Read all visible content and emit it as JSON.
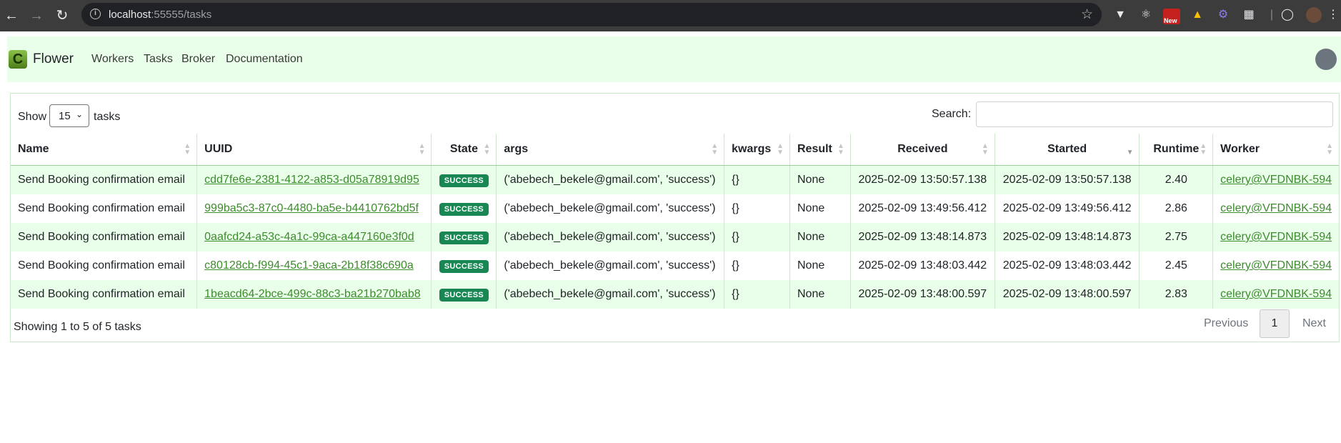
{
  "browser": {
    "url_host": "localhost",
    "url_rest": ":55555/tasks",
    "new_badge": "New"
  },
  "nav": {
    "brand": "Flower",
    "links": [
      "Workers",
      "Tasks",
      "Broker",
      "Documentation"
    ]
  },
  "table_controls": {
    "show_label": "Show",
    "page_size": "15",
    "tasks_label": "tasks",
    "search_label": "Search:"
  },
  "columns": [
    "Name",
    "UUID",
    "State",
    "args",
    "kwargs",
    "Result",
    "Received",
    "Started",
    "Runtime",
    "Worker"
  ],
  "rows": [
    {
      "name": "Send Booking confirmation email",
      "uuid": "cdd7fe6e-2381-4122-a853-d05a78919d95",
      "state": "SUCCESS",
      "args": "('abebech_bekele@gmail.com', 'success')",
      "kwargs": "{}",
      "result": "None",
      "received": "2025-02-09 13:50:57.138",
      "started": "2025-02-09 13:50:57.138",
      "runtime": "2.40",
      "worker": "celery@VFDNBK-594"
    },
    {
      "name": "Send Booking confirmation email",
      "uuid": "999ba5c3-87c0-4480-ba5e-b4410762bd5f",
      "state": "SUCCESS",
      "args": "('abebech_bekele@gmail.com', 'success')",
      "kwargs": "{}",
      "result": "None",
      "received": "2025-02-09 13:49:56.412",
      "started": "2025-02-09 13:49:56.412",
      "runtime": "2.86",
      "worker": "celery@VFDNBK-594"
    },
    {
      "name": "Send Booking confirmation email",
      "uuid": "0aafcd24-a53c-4a1c-99ca-a447160e3f0d",
      "state": "SUCCESS",
      "args": "('abebech_bekele@gmail.com', 'success')",
      "kwargs": "{}",
      "result": "None",
      "received": "2025-02-09 13:48:14.873",
      "started": "2025-02-09 13:48:14.873",
      "runtime": "2.75",
      "worker": "celery@VFDNBK-594"
    },
    {
      "name": "Send Booking confirmation email",
      "uuid": "c80128cb-f994-45c1-9aca-2b18f38c690a",
      "state": "SUCCESS",
      "args": "('abebech_bekele@gmail.com', 'success')",
      "kwargs": "{}",
      "result": "None",
      "received": "2025-02-09 13:48:03.442",
      "started": "2025-02-09 13:48:03.442",
      "runtime": "2.45",
      "worker": "celery@VFDNBK-594"
    },
    {
      "name": "Send Booking confirmation email",
      "uuid": "1beacd64-2bce-499c-88c3-ba21b270bab8",
      "state": "SUCCESS",
      "args": "('abebech_bekele@gmail.com', 'success')",
      "kwargs": "{}",
      "result": "None",
      "received": "2025-02-09 13:48:00.597",
      "started": "2025-02-09 13:48:00.597",
      "runtime": "2.83",
      "worker": "celery@VFDNBK-594"
    }
  ],
  "footer": {
    "info": "Showing 1 to 5 of 5 tasks",
    "previous": "Previous",
    "page": "1",
    "next": "Next"
  },
  "colors": {
    "navbar_bg": "#eaffea",
    "stripe": "#eaffea",
    "success_badge": "#198754",
    "link": "#3c8c2c"
  }
}
